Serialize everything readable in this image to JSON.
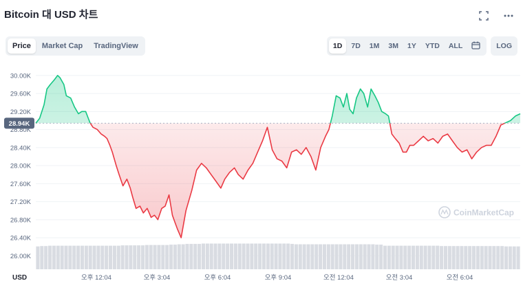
{
  "header": {
    "title": "Bitcoin 대 USD 차트"
  },
  "tabs": [
    {
      "label": "Price",
      "active": true
    },
    {
      "label": "Market Cap",
      "active": false
    },
    {
      "label": "TradingView",
      "active": false
    }
  ],
  "ranges": [
    {
      "label": "1D",
      "active": true
    },
    {
      "label": "7D",
      "active": false
    },
    {
      "label": "1M",
      "active": false
    },
    {
      "label": "3M",
      "active": false
    },
    {
      "label": "1Y",
      "active": false
    },
    {
      "label": "YTD",
      "active": false
    },
    {
      "label": "ALL",
      "active": false
    }
  ],
  "log_label": "LOG",
  "icons": {
    "expand": "expand-icon",
    "more": "more-icon",
    "calendar": "calendar-icon"
  },
  "currency_label": "USD",
  "watermark": "CoinMarketCap",
  "colors": {
    "up": "#16c784",
    "down": "#ea3943",
    "volume": "#d9dce2",
    "grid": "#eff2f5",
    "text": "#58667e"
  },
  "chart_data": {
    "type": "line",
    "current_price_label": "28.94K",
    "baseline": 28940,
    "ylim": [
      25700,
      30150
    ],
    "y_ticks": [
      {
        "value": 30000,
        "label": "30.00K"
      },
      {
        "value": 29600,
        "label": "29.60K"
      },
      {
        "value": 29200,
        "label": "29.20K"
      },
      {
        "value": 28800,
        "label": "28.80K"
      },
      {
        "value": 28400,
        "label": "28.40K"
      },
      {
        "value": 28000,
        "label": "28.00K"
      },
      {
        "value": 27600,
        "label": "27.60K"
      },
      {
        "value": 27200,
        "label": "27.20K"
      },
      {
        "value": 26800,
        "label": "26.80K"
      },
      {
        "value": 26400,
        "label": "26.40K"
      },
      {
        "value": 26000,
        "label": "26.00K"
      }
    ],
    "x_ticks": [
      {
        "pos": 0.125,
        "label": "오후 12:04"
      },
      {
        "pos": 0.25,
        "label": "오후 3:04"
      },
      {
        "pos": 0.375,
        "label": "오후 6:04"
      },
      {
        "pos": 0.5,
        "label": "오후 9:04"
      },
      {
        "pos": 0.625,
        "label": "오전 12:04"
      },
      {
        "pos": 0.75,
        "label": "오전 3:04"
      },
      {
        "pos": 0.875,
        "label": "오전 6:04"
      }
    ],
    "series": [
      {
        "x": [
          0,
          0.008,
          0.017,
          0.023,
          0.03,
          0.038,
          0.045,
          0.05,
          0.058,
          0.063,
          0.072,
          0.08,
          0.088,
          0.095,
          0.103,
          0.112,
          0.118,
          0.127,
          0.135,
          0.142,
          0.147,
          0.153,
          0.158,
          0.166,
          0.172,
          0.18,
          0.188,
          0.195,
          0.2,
          0.207,
          0.215,
          0.222,
          0.23,
          0.238,
          0.245,
          0.252,
          0.26,
          0.267,
          0.275,
          0.282,
          0.287,
          0.292,
          0.3,
          0.31,
          0.322,
          0.332,
          0.342,
          0.352,
          0.362,
          0.372,
          0.382,
          0.39,
          0.4,
          0.41,
          0.418,
          0.428,
          0.438,
          0.448,
          0.458,
          0.468,
          0.478,
          0.488,
          0.498,
          0.508,
          0.518,
          0.528,
          0.538,
          0.548,
          0.558,
          0.568,
          0.578,
          0.588,
          0.598,
          0.605,
          0.612,
          0.62,
          0.628,
          0.635,
          0.642,
          0.648,
          0.655,
          0.662,
          0.67,
          0.677,
          0.685,
          0.692,
          0.7,
          0.707,
          0.714,
          0.722,
          0.728,
          0.735,
          0.742,
          0.75,
          0.758,
          0.765,
          0.772,
          0.78,
          0.79,
          0.8,
          0.81,
          0.82,
          0.83,
          0.84,
          0.85,
          0.86,
          0.87,
          0.88,
          0.89,
          0.9,
          0.91,
          0.92,
          0.93,
          0.94,
          0.95,
          0.96,
          0.97,
          0.98,
          0.99,
          1.0
        ],
        "y": [
          28940,
          29050,
          29350,
          29700,
          29800,
          29900,
          30000,
          29950,
          29800,
          29550,
          29500,
          29300,
          29150,
          29200,
          29200,
          28950,
          28850,
          28800,
          28700,
          28650,
          28600,
          28450,
          28300,
          28000,
          27800,
          27550,
          27700,
          27500,
          27300,
          27050,
          27100,
          26950,
          27050,
          26850,
          26900,
          26800,
          27050,
          27100,
          27350,
          26900,
          26750,
          26600,
          26400,
          27000,
          27450,
          27900,
          28050,
          27950,
          27800,
          27650,
          27500,
          27700,
          27850,
          27950,
          27800,
          27700,
          27900,
          28050,
          28300,
          28550,
          28850,
          28350,
          28150,
          28100,
          27950,
          28300,
          28350,
          28250,
          28400,
          28200,
          27900,
          28400,
          28650,
          28800,
          29100,
          29550,
          29500,
          29300,
          29600,
          29250,
          29150,
          29500,
          29700,
          29600,
          29300,
          29700,
          29550,
          29400,
          29200,
          29150,
          29100,
          28700,
          28600,
          28500,
          28300,
          28300,
          28450,
          28450,
          28550,
          28650,
          28550,
          28600,
          28500,
          28650,
          28700,
          28550,
          28400,
          28300,
          28350,
          28150,
          28300,
          28400,
          28450,
          28450,
          28650,
          28900,
          28950,
          29000,
          29100,
          29150
        ]
      }
    ],
    "volume": [
      0.64,
      0.65,
      0.65,
      0.66,
      0.66,
      0.66,
      0.66,
      0.66,
      0.66,
      0.66,
      0.66,
      0.66,
      0.66,
      0.66,
      0.66,
      0.66,
      0.66,
      0.66,
      0.66,
      0.66,
      0.66,
      0.67,
      0.67,
      0.67,
      0.67,
      0.67,
      0.67,
      0.68,
      0.68,
      0.68,
      0.68,
      0.68,
      0.68,
      0.69,
      0.69,
      0.7,
      0.7,
      0.71,
      0.71,
      0.71,
      0.71,
      0.72,
      0.72,
      0.72,
      0.72,
      0.72,
      0.72,
      0.72,
      0.72,
      0.72,
      0.72,
      0.72,
      0.72,
      0.72,
      0.72,
      0.72,
      0.72,
      0.72,
      0.72,
      0.72,
      0.72,
      0.72,
      0.72,
      0.71,
      0.7,
      0.7,
      0.7,
      0.7,
      0.7,
      0.7,
      0.7,
      0.7,
      0.7,
      0.7,
      0.7,
      0.7,
      0.7,
      0.7,
      0.7,
      0.7,
      0.7,
      0.7,
      0.7,
      0.7,
      0.69,
      0.69,
      0.66,
      0.66,
      0.66,
      0.66,
      0.66,
      0.66,
      0.66,
      0.66,
      0.66,
      0.66,
      0.66,
      0.66,
      0.66,
      0.66,
      0.65,
      0.65,
      0.65,
      0.65,
      0.65,
      0.65,
      0.65,
      0.65,
      0.65,
      0.65,
      0.65,
      0.65,
      0.65,
      0.65,
      0.65,
      0.65,
      0.64,
      0.64,
      0.64,
      0.64
    ]
  }
}
